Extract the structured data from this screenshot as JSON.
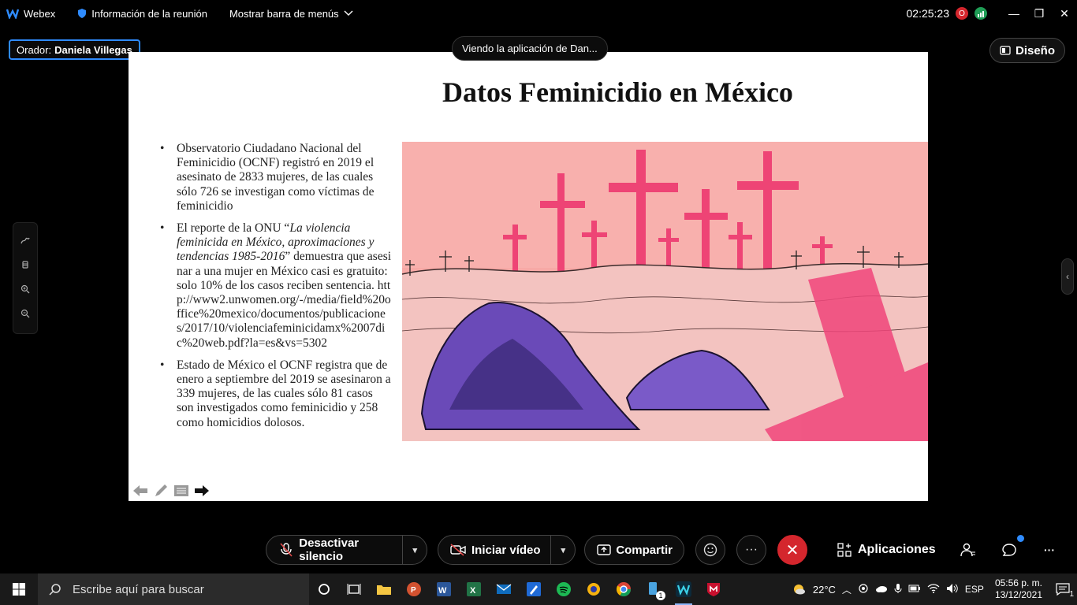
{
  "titlebar": {
    "app_name": "Webex",
    "meeting_info": "Información de la reunión",
    "menu_toggle": "Mostrar barra de menús",
    "clock": "02:25:23",
    "badge_letter": "O",
    "minimize_glyph": "—",
    "restore_glyph": "❐",
    "close_glyph": "✕"
  },
  "speaker": {
    "prefix": "Orador:",
    "name": "Daniela Villegas"
  },
  "viewing_label": "Viendo la aplicación de Dan...",
  "layout_button": "Diseño",
  "slide": {
    "title": "Datos Feminicidio en México",
    "bullet1": "Observatorio Ciudadano Nacional del Feminicidio (OCNF) registró en 2019 el asesinato de 2833 mujeres, de las cuales sólo 726 se investigan como víctimas de feminicidio",
    "bullet2_a": "El reporte de la ONU “",
    "bullet2_italic": "La violencia feminicida en México, aproximaciones y tendencias 1985-2016",
    "bullet2_b": "” demuestra que asesinar a una mujer en México casi es gratuito: solo 10% de los casos reciben sentencia. http://www2.unwomen.org/-/media/field%20office%20mexico/documentos/publicaciones/2017/10/violenciafeminicidamx%2007dic%20web.pdf?la=es&vs=5302",
    "bullet3": "Estado de México el OCNF registra que de enero a septiembre del 2019 se asesinaron a 339 mujeres, de las cuales sólo 81 casos son investigados como feminicidio y 258 como homicidios dolosos."
  },
  "controls": {
    "mute": "Desactivar silencio",
    "video": "Iniciar vídeo",
    "share": "Compartir",
    "more": "···",
    "end": "✕",
    "apps": "Aplicaciones",
    "overflow": "···"
  },
  "taskbar": {
    "search_placeholder": "Escribe aquí para buscar",
    "weather": "22°C",
    "language": "ESP",
    "time": "05:56 p. m.",
    "date": "13/12/2021",
    "notifications": "1",
    "badge_count": "1"
  },
  "colors": {
    "accent_blue": "#2f8cff",
    "end_call_red": "#d4262d",
    "cross_pink": "#f0457a"
  }
}
